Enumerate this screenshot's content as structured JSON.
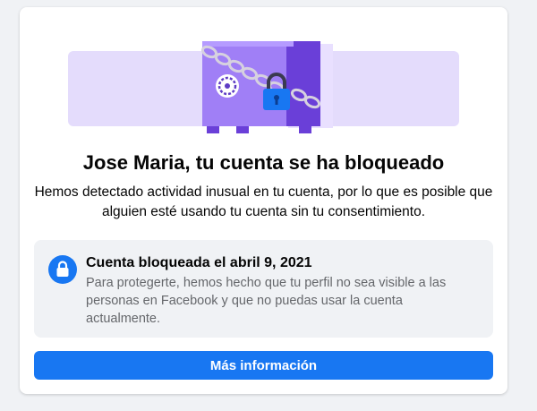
{
  "notice": {
    "title": "Jose Maria, tu cuenta se ha bloqueado",
    "description": "Hemos detectado actividad inusual en tu cuenta, por lo que es posible que alguien esté usando tu cuenta sin tu consentimiento."
  },
  "info": {
    "icon": "lock-icon",
    "title": "Cuenta bloqueada el abril 9, 2021",
    "text": "Para protegerte, hemos hecho que tu perfil no sea visible a las personas en Facebook y que no puedas usar la cuenta actualmente."
  },
  "actions": {
    "more_info_label": "Más información"
  },
  "colors": {
    "accent": "#1877f2",
    "background": "#f0f2f5",
    "illustration_bg": "#e4dcfc",
    "safe_purple": "#9c7cf4",
    "safe_dark": "#6e48d8"
  }
}
